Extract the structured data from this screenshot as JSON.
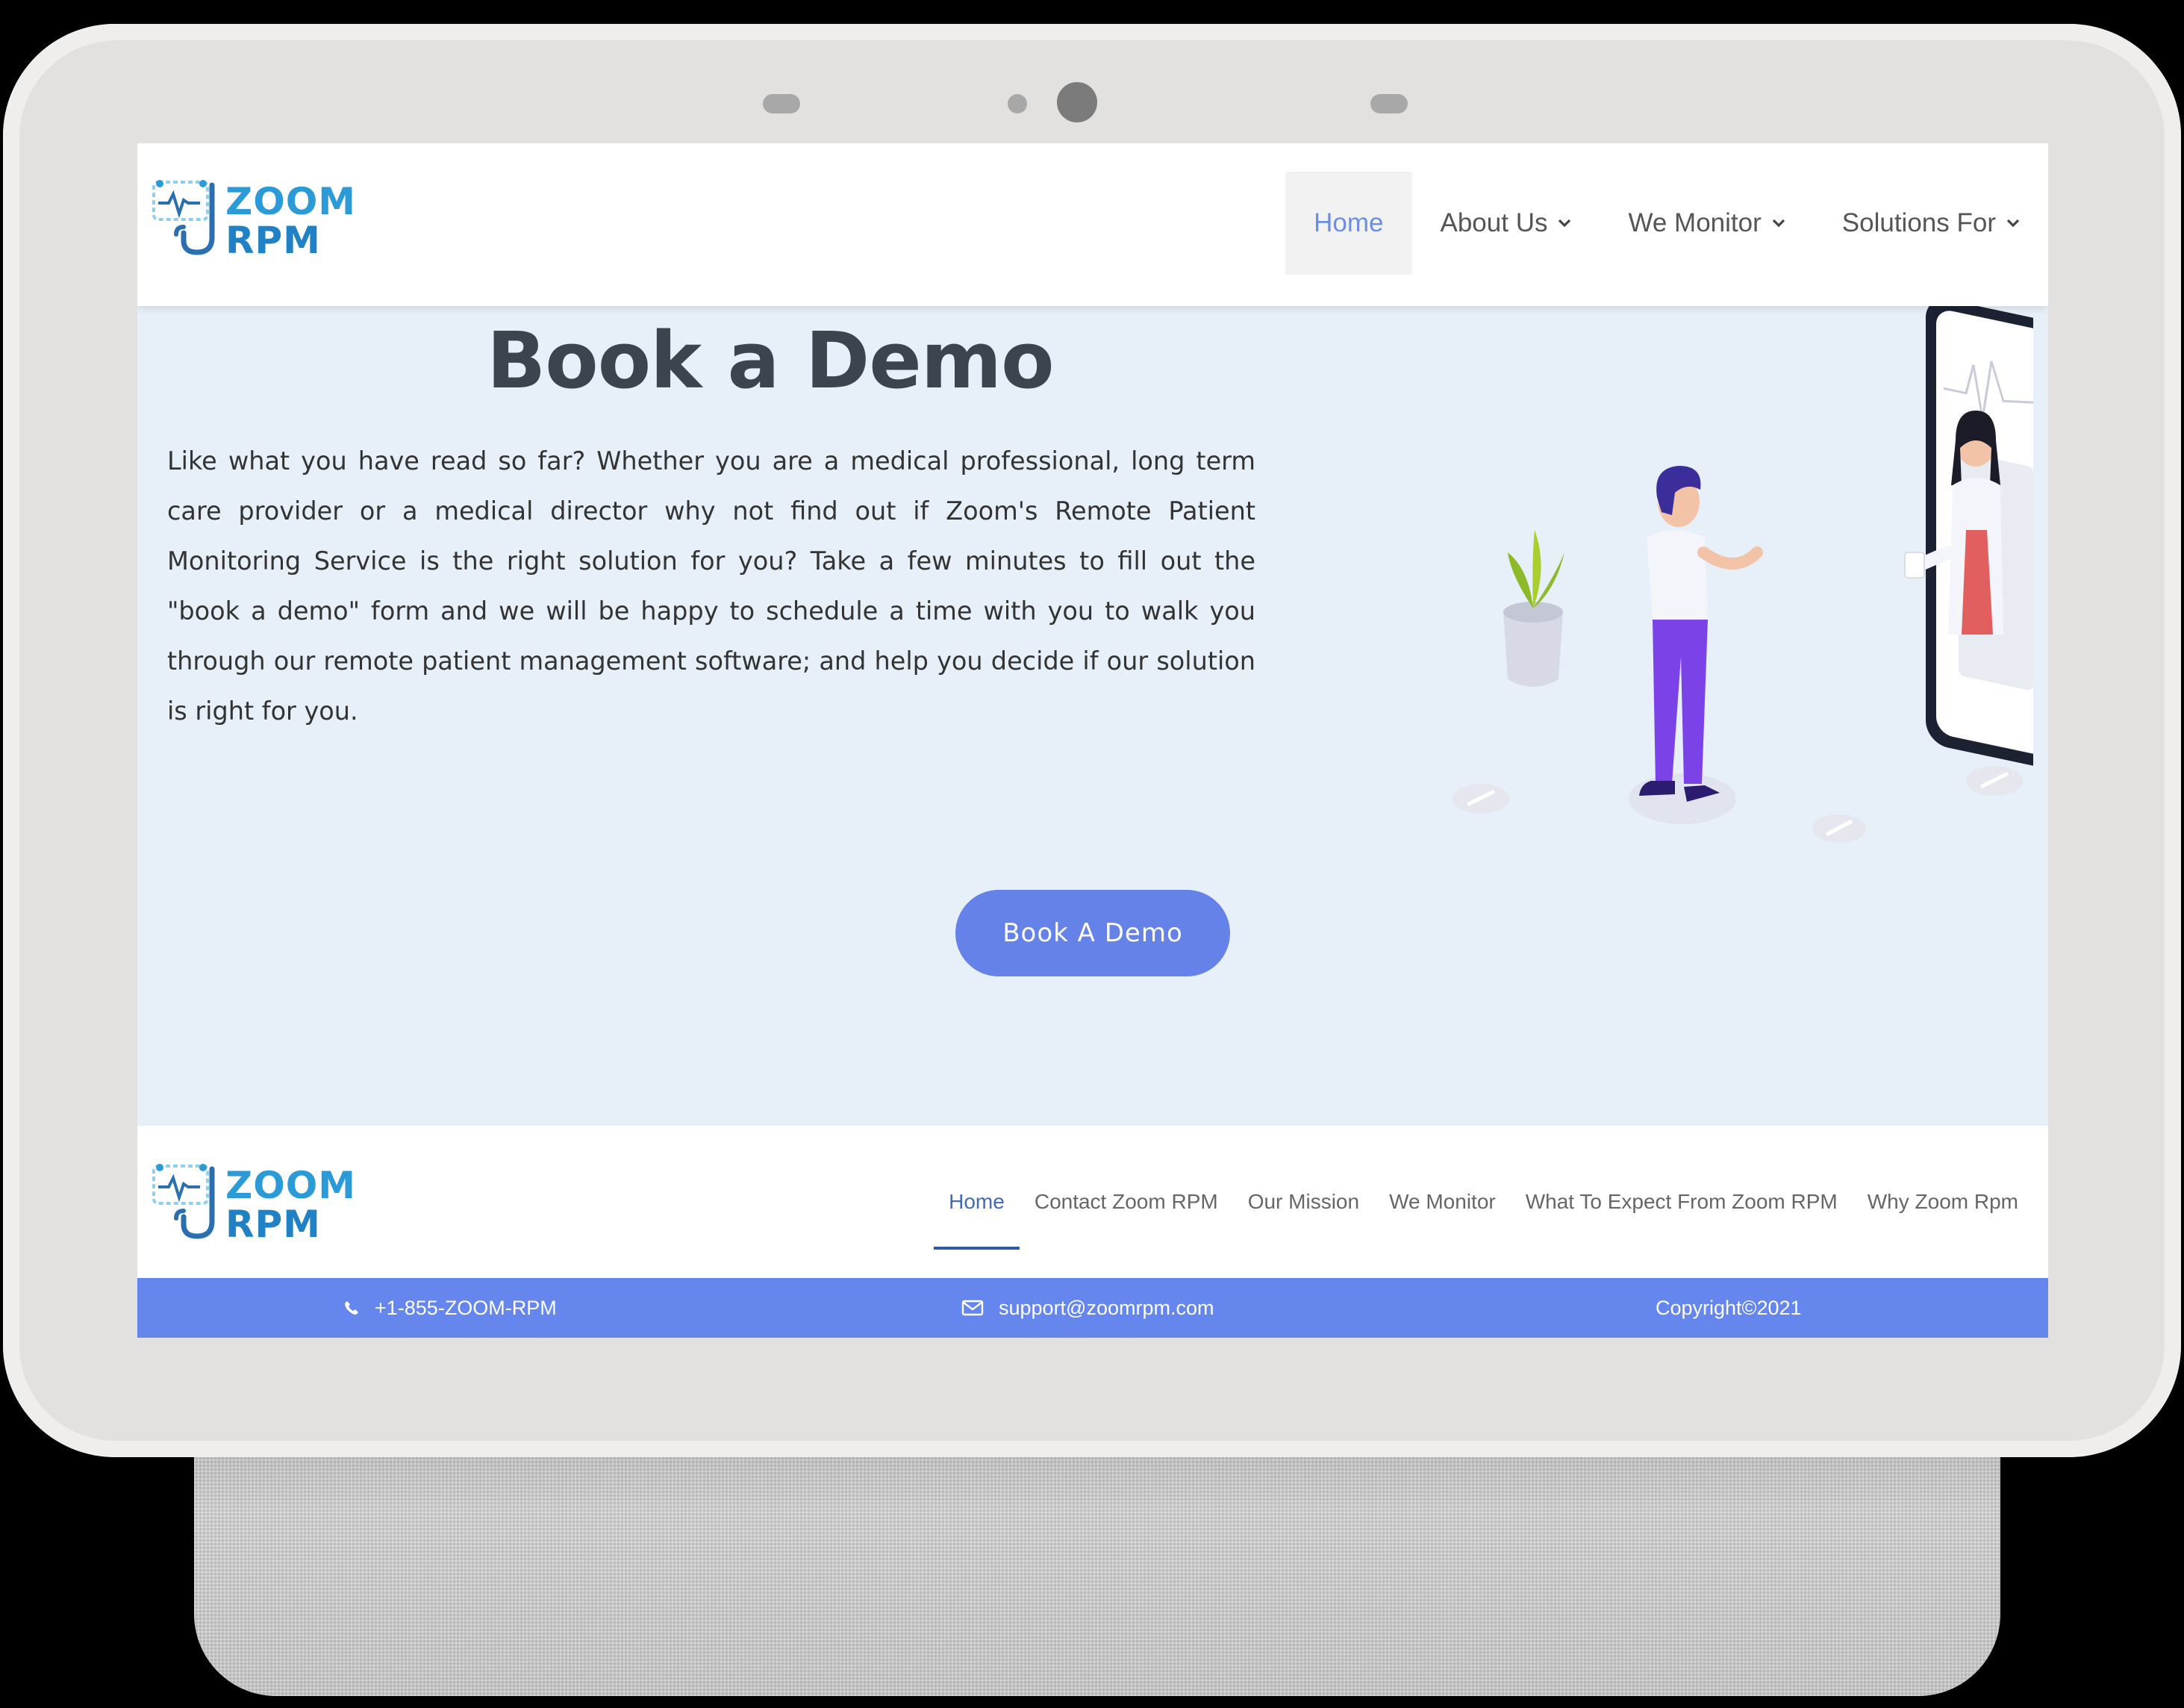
{
  "brand": {
    "line1": "ZOOM",
    "line2": "RPM"
  },
  "nav": {
    "items": [
      {
        "label": "Home",
        "active": true,
        "dropdown": false
      },
      {
        "label": "About Us",
        "active": false,
        "dropdown": true
      },
      {
        "label": "We Monitor",
        "active": false,
        "dropdown": true
      },
      {
        "label": "Solutions For",
        "active": false,
        "dropdown": true
      }
    ]
  },
  "hero": {
    "title": "Book a Demo",
    "text": "Like what you have read so far? Whether you are a medical professional, long term care provider or a medical director why not find out if Zoom's Remote Patient Monitoring Service is the right solution for you? Take a few minutes to fill out the \"book a demo\" form and we will be happy to schedule a time with you to walk you through our remote patient management software; and help you decide if our solution is right for you.",
    "cta_label": "Book A Demo"
  },
  "footer": {
    "nav": [
      {
        "label": "Home",
        "active": true
      },
      {
        "label": "Contact Zoom RPM",
        "active": false
      },
      {
        "label": "Our Mission",
        "active": false
      },
      {
        "label": "We Monitor",
        "active": false
      },
      {
        "label": "What To Expect From Zoom RPM",
        "active": false
      },
      {
        "label": "Why Zoom Rpm",
        "active": false
      }
    ],
    "phone": "+1-855-ZOOM-RPM",
    "email": "support@zoomrpm.com",
    "copyright": "Copyright©2021"
  },
  "icons": {
    "phone": "phone-icon",
    "email": "envelope-icon",
    "chevron": "chevron-down-icon",
    "logo": "stethoscope-logo-icon"
  },
  "colors": {
    "accent": "#6586ec",
    "button": "#6482e8",
    "hero_bg": "#e7f0f8",
    "title": "#3a4550",
    "logo_blue": "#2a9bd6",
    "nav_active": "#6b8fe6"
  }
}
